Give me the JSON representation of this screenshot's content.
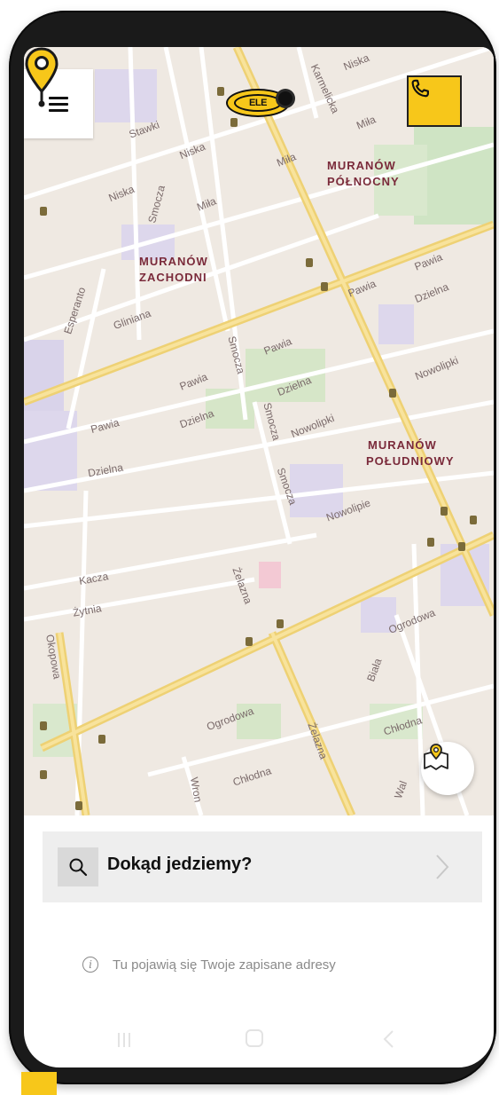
{
  "map": {
    "districts": [
      {
        "line1": "MURANÓW",
        "line2": "PÓŁNOCNY"
      },
      {
        "line1": "MURANÓW",
        "line2": "ZACHODNI"
      },
      {
        "line1": "MURANÓW",
        "line2": "POŁUDNIOWY"
      }
    ],
    "streets": [
      "Stawki",
      "Niska",
      "Karmelicka",
      "Miła",
      "Smocza",
      "Gliniana",
      "Esperanto",
      "Pawia",
      "Dzielna",
      "Nowolipki",
      "Nowolipie",
      "Kacza",
      "Żytnia",
      "Okopowa",
      "Żelazna",
      "Ogrodowa",
      "Biała",
      "Chłodna",
      "Wron",
      "Wal"
    ]
  },
  "header": {
    "logo_text": "ELE",
    "menu_icon": "hamburger-menu-icon",
    "call_icon": "phone-icon"
  },
  "search": {
    "placeholder": "Dokąd jedziemy?"
  },
  "saved_addresses": {
    "empty_message": "Tu pojawią się Twoje zapisane adresy"
  },
  "colors": {
    "brand_yellow": "#f7c71a",
    "map_background": "#efe9e2",
    "major_road": "#f4d774"
  }
}
